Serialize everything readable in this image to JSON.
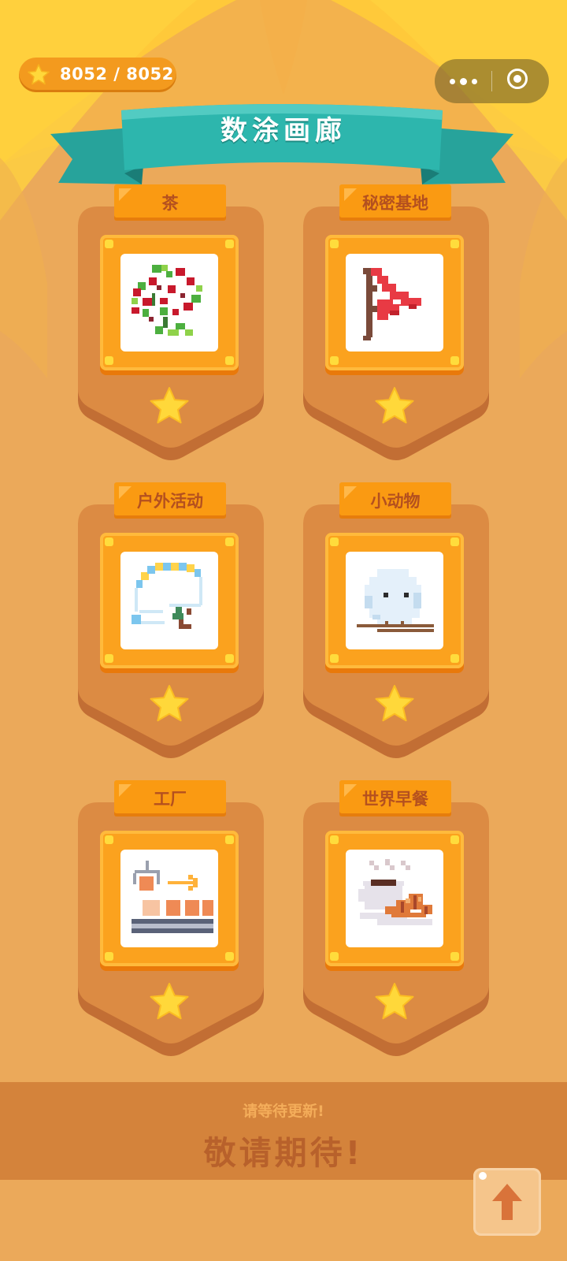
{
  "header": {
    "star_count": "8052 / 8052",
    "title": "数涂画廊"
  },
  "capsule": {
    "more_icon": "more-dots-icon",
    "close_icon": "close-target-icon"
  },
  "albums": [
    {
      "label": "茶",
      "art": "tea-branch-pixel-art",
      "stars_earned": 1
    },
    {
      "label": "秘密基地",
      "art": "pennant-flag-pixel-art",
      "stars_earned": 1
    },
    {
      "label": "户外活动",
      "art": "hang-glider-pixel-art",
      "stars_earned": 1
    },
    {
      "label": "小动物",
      "art": "small-bird-pixel-art",
      "stars_earned": 1
    },
    {
      "label": "工厂",
      "art": "factory-conveyor-pixel-art",
      "stars_earned": 1
    },
    {
      "label": "世界早餐",
      "art": "coffee-croissant-pixel-art",
      "stars_earned": 1
    }
  ],
  "footer": {
    "subtitle": "请等待更新!",
    "main": "敬请期待!"
  },
  "scroll_top_icon": "arrow-up-icon",
  "colors": {
    "background": "#eba95a",
    "banner": "#2db6ad",
    "card_frame": "#fba21e",
    "star": "#ffd83a",
    "label_text": "#b4501f"
  }
}
